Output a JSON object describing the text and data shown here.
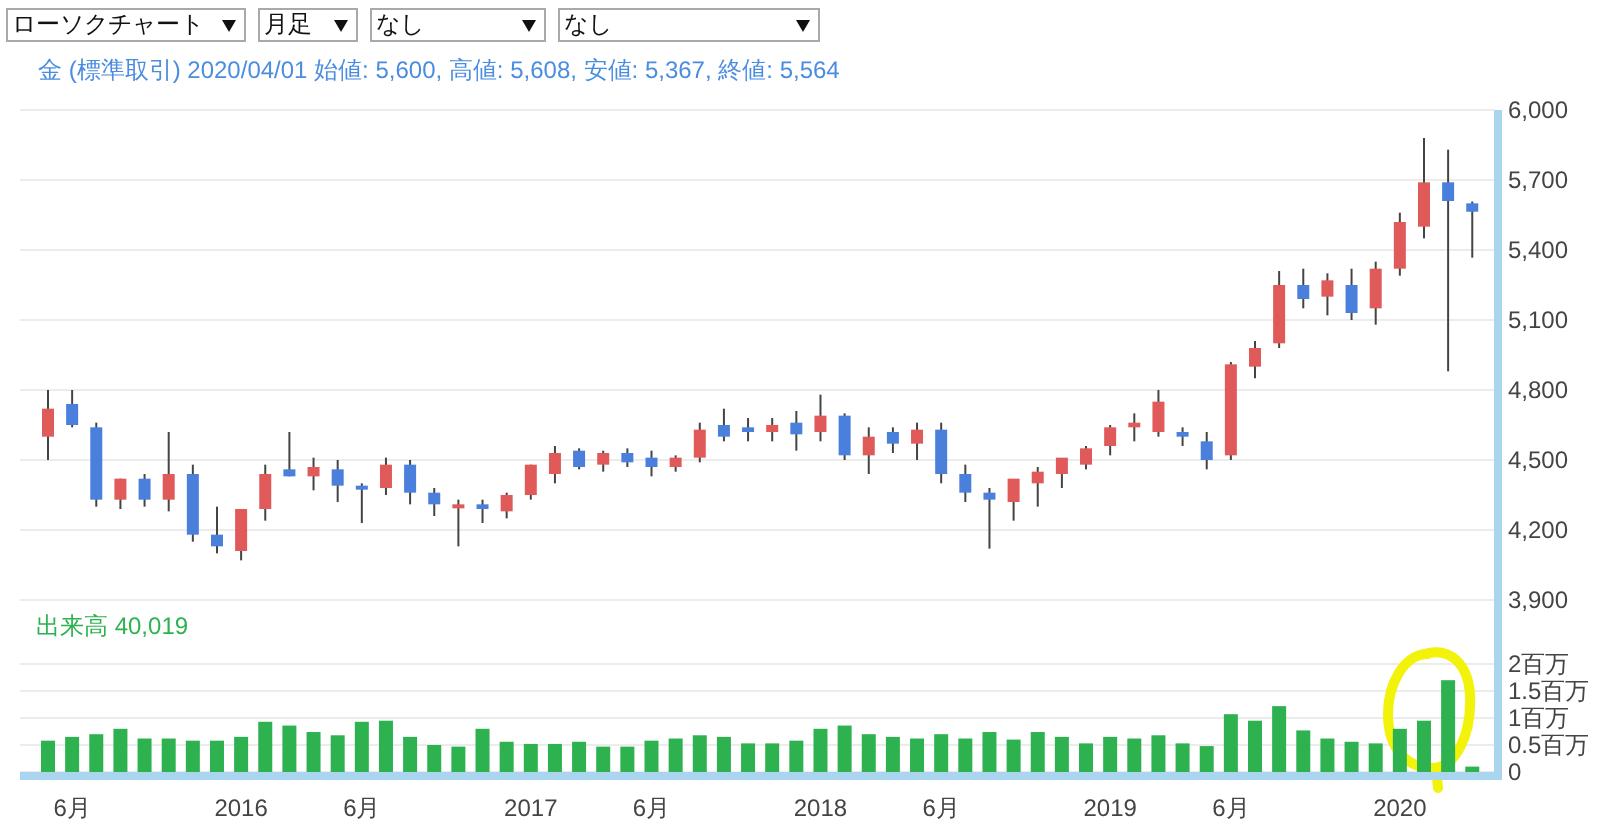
{
  "toolbar": {
    "dropdowns": [
      {
        "value": "ローソクチャート"
      },
      {
        "value": "月足"
      },
      {
        "value": "なし"
      },
      {
        "value": "なし"
      }
    ]
  },
  "info_line": "金 (標準取引) 2020/04/01 始値: 5,600, 高値: 5,608, 安値: 5,367, 終値: 5,564",
  "price_chart": {
    "axis_labels": [
      "6,000",
      "5,700",
      "5,400",
      "5,100",
      "4,800",
      "4,500",
      "4,200",
      "3,900"
    ]
  },
  "volume_chart": {
    "reading": "40,019",
    "x_axis_labels": [
      "6月",
      "2016",
      "6月",
      "2017",
      "6月",
      "2018",
      "6月",
      "2019",
      "6月",
      "2020"
    ],
    "chart_data": {
      "type": "bar",
      "grid": true,
      "ylim": [
        0,
        2
      ],
      "yticks": [
        {
          "value": 0,
          "label": "0"
        },
        {
          "value": 0.5,
          "label": "0.5百万"
        },
        {
          "value": 1,
          "label": "1百万"
        },
        {
          "value": 1.5,
          "label": "1.5百万"
        },
        {
          "value": 2,
          "label": "2百万"
        }
      ],
      "series": [
        {
          "name": "出来高",
          "color": "#2eb24f",
          "values": [
            0.58,
            0.65,
            0.7,
            0.8,
            0.62,
            0.62,
            0.58,
            0.58,
            0.65,
            0.93,
            0.86,
            0.74,
            0.68,
            0.93,
            0.95,
            0.65,
            0.5,
            0.47,
            0.8,
            0.56,
            0.52,
            0.52,
            0.56,
            0.47,
            0.47,
            0.58,
            0.62,
            0.68,
            0.65,
            0.53,
            0.53,
            0.58,
            0.8,
            0.86,
            0.7,
            0.65,
            0.62,
            0.7,
            0.62,
            0.74,
            0.6,
            0.74,
            0.65,
            0.53,
            0.65,
            0.62,
            0.68,
            0.53,
            0.48,
            1.07,
            0.95,
            1.22,
            0.77,
            0.62,
            0.56,
            0.53,
            0.8,
            0.95,
            1.7,
            0.1
          ]
        }
      ]
    }
  }
}
